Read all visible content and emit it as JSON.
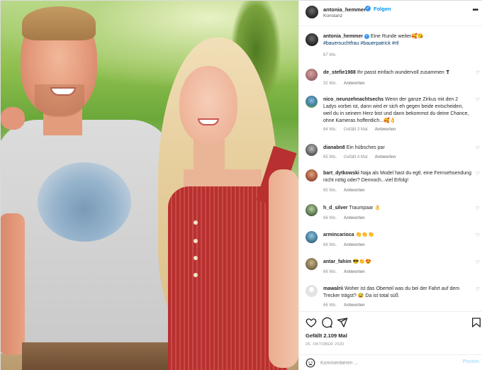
{
  "post": {
    "author": {
      "username": "antonia_hemmer",
      "location": "Konstanz",
      "follow_label": "Folgen",
      "separator": "•"
    },
    "caption": {
      "username": "antonia_hemmer",
      "text": " Eine Runde weiter🥰😘",
      "hashtags": "#bauersuchtfrau #bauerpatrick #rtl",
      "age": "67 Wo."
    },
    "comments": [
      {
        "username": "de_stefie1988",
        "text": " Ihr passt einfach wundervoll zusammen ❣",
        "age": "32 Wo.",
        "likes": "",
        "reply": "Antworten"
      },
      {
        "username": "nico_neunzehnachtsechs",
        "text": " Wenn der ganze Zirkus mit den 2 Ladys vorbei ist, dann wird er sich eh gegen beide entscheiden, weil du in seinem Herz bist und dann bekommst du deine Chance, ohne Kameras hoffentlich...🥰👌",
        "age": "64 Wo.",
        "likes": "Gefällt 3 Mal",
        "reply": "Antworten"
      },
      {
        "username": "dianabn8",
        "text": " Ein hübsches par",
        "age": "65 Wo.",
        "likes": "Gefällt 4 Mal",
        "reply": "Antworten"
      },
      {
        "username": "bart_dytkowski",
        "text": " Naja als Model hast du egtl. eine Fernsehsendung nicht nötig oder? Dennoch...viel Erfolg!",
        "age": "65 Wo.",
        "likes": "",
        "reply": "Antworten"
      },
      {
        "username": "h_d_silver",
        "text": " Traumpaar 👌",
        "age": "66 Wo.",
        "likes": "",
        "reply": "Antworten"
      },
      {
        "username": "armincarioca",
        "text": " 👏👏👏",
        "age": "66 Wo.",
        "likes": "",
        "reply": "Antworten"
      },
      {
        "username": "antar_fahim",
        "text": " 😎👏😍",
        "age": "66 Wo.",
        "likes": "",
        "reply": "Antworten"
      },
      {
        "username": "mawalrii",
        "text": " Woher ist das Oberteil was du bei der Fahrt auf dem Trecker trägst? 😅 Da ist total süß",
        "age": "66 Wo.",
        "likes": "",
        "reply": "Antworten"
      }
    ],
    "likes_text": "Gefällt 2.109 Mal",
    "date": "26. OKTOBER 2020",
    "comment_input": {
      "placeholder": "Kommentieren ...",
      "value": "",
      "post_label": "Posten"
    },
    "icons": {
      "like": "heart-icon",
      "comment": "comment-icon",
      "share": "send-icon",
      "save": "bookmark-icon",
      "more": "more-options-icon",
      "verified": "verified-badge-icon",
      "emoji": "emoji-icon"
    },
    "colors": {
      "link_blue": "#0095f6",
      "hashtag_blue": "#00376b",
      "muted": "#8e8e8e",
      "dress_red": "#b8302f"
    }
  }
}
